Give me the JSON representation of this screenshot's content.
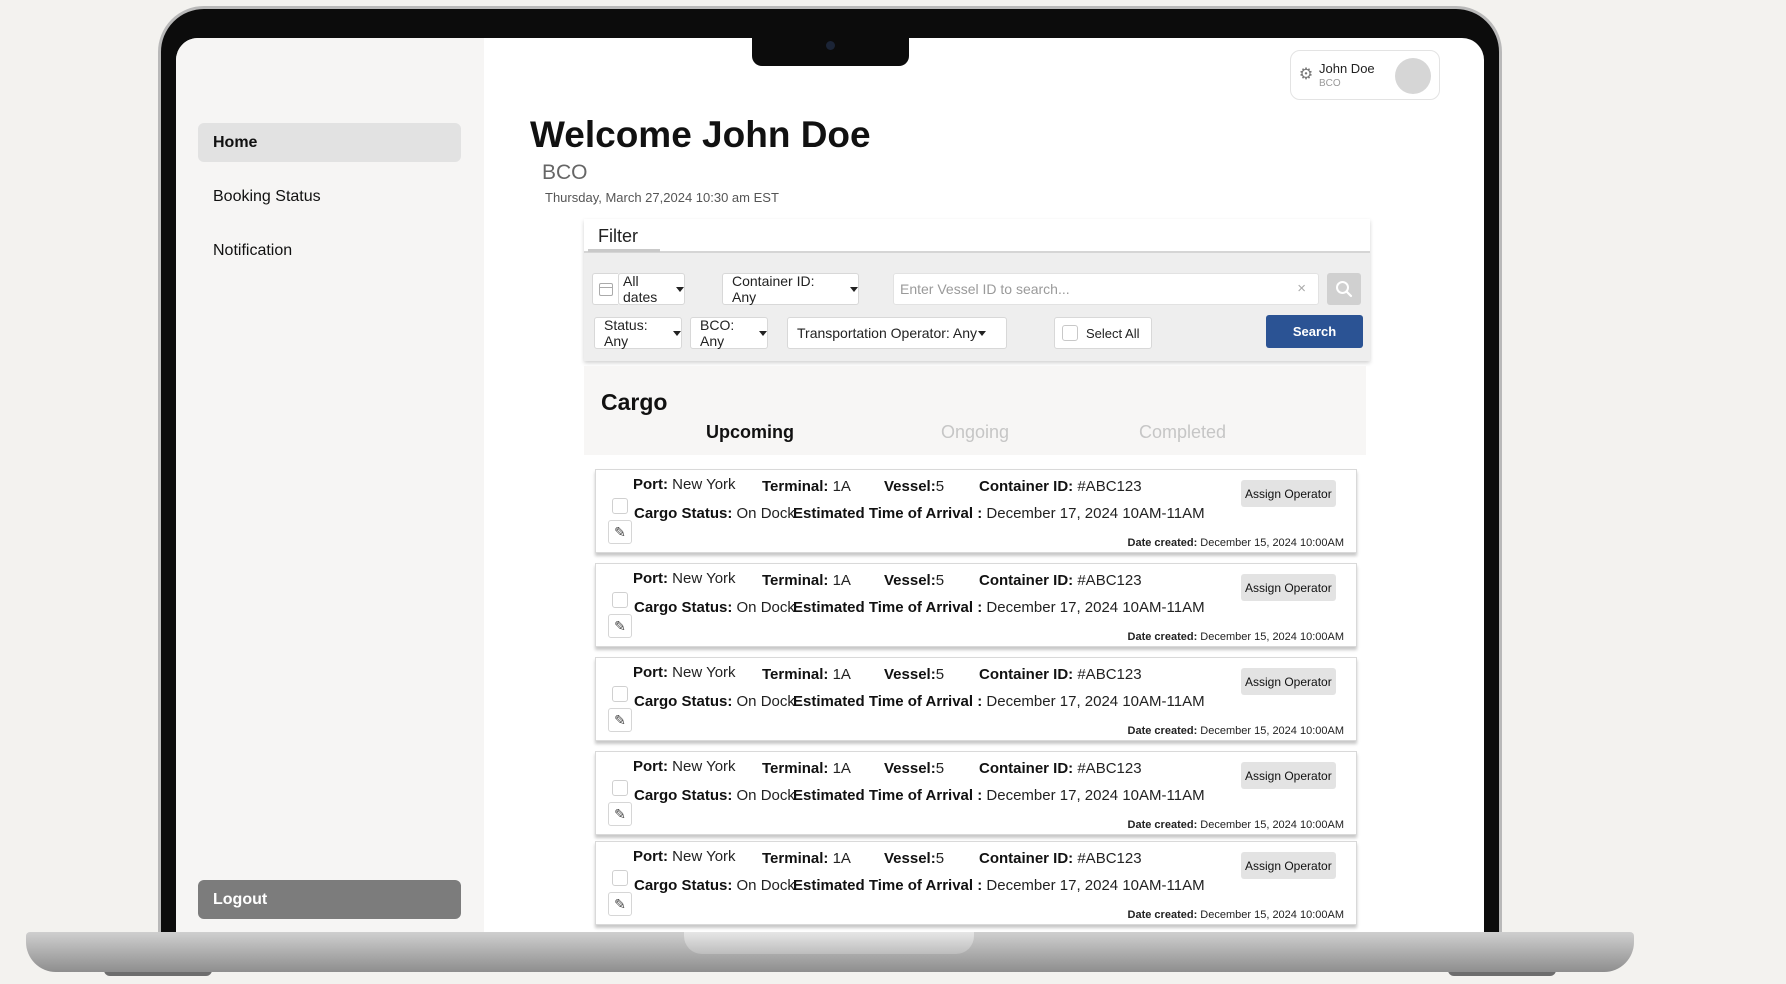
{
  "sidebar": {
    "items": [
      {
        "label": "Home"
      },
      {
        "label": "Booking Status"
      },
      {
        "label": "Notification"
      }
    ],
    "logout_label": "Logout"
  },
  "user": {
    "name": "John Doe",
    "role": "BCO"
  },
  "header": {
    "welcome": "Welcome John Doe",
    "role": "BCO",
    "datetime": "Thursday, March 27,2024 10:30 am EST"
  },
  "filter": {
    "tab_label": "Filter",
    "dates": "All dates",
    "container": "Container ID: Any",
    "vessel_placeholder": "Enter Vessel ID to search...",
    "clear": "×",
    "status": "Status: Any",
    "bco": "BCO: Any",
    "operator": "Transportation Operator: Any",
    "select_all": "Select All",
    "search_label": "Search"
  },
  "cargo": {
    "title": "Cargo",
    "tabs": [
      "Upcoming",
      "Ongoing",
      "Completed"
    ],
    "labels": {
      "port": "Port:",
      "terminal": "Terminal:",
      "vessel": "Vessel:",
      "container": "Container ID:",
      "status": "Cargo Status:",
      "eta": "Estimated Time of Arrival :",
      "created": "Date created:",
      "assign": "Assign Operator"
    },
    "rows": [
      {
        "port": "New York",
        "terminal": "1A",
        "vessel": "5",
        "container": "#ABC123",
        "status": "On Dock",
        "eta": "December 17, 2024 10AM-11AM",
        "created": "December 15, 2024 10:00AM"
      },
      {
        "port": "New York",
        "terminal": "1A",
        "vessel": "5",
        "container": "#ABC123",
        "status": "On Dock",
        "eta": "December 17, 2024 10AM-11AM",
        "created": "December 15, 2024 10:00AM"
      },
      {
        "port": "New York",
        "terminal": "1A",
        "vessel": "5",
        "container": "#ABC123",
        "status": "On Dock",
        "eta": "December 17, 2024 10AM-11AM",
        "created": "December 15, 2024 10:00AM"
      },
      {
        "port": "New York",
        "terminal": "1A",
        "vessel": "5",
        "container": "#ABC123",
        "status": "On Dock",
        "eta": "December 17, 2024 10AM-11AM",
        "created": "December 15, 2024 10:00AM"
      },
      {
        "port": "New York",
        "terminal": "1A",
        "vessel": "5",
        "container": "#ABC123",
        "status": "On Dock",
        "eta": "December 17, 2024 10AM-11AM",
        "created": "December 15, 2024 10:00AM"
      }
    ]
  },
  "colors": {
    "accent": "#2b5394",
    "logout": "#7c7c7c",
    "active_nav": "#e2e2e2"
  }
}
